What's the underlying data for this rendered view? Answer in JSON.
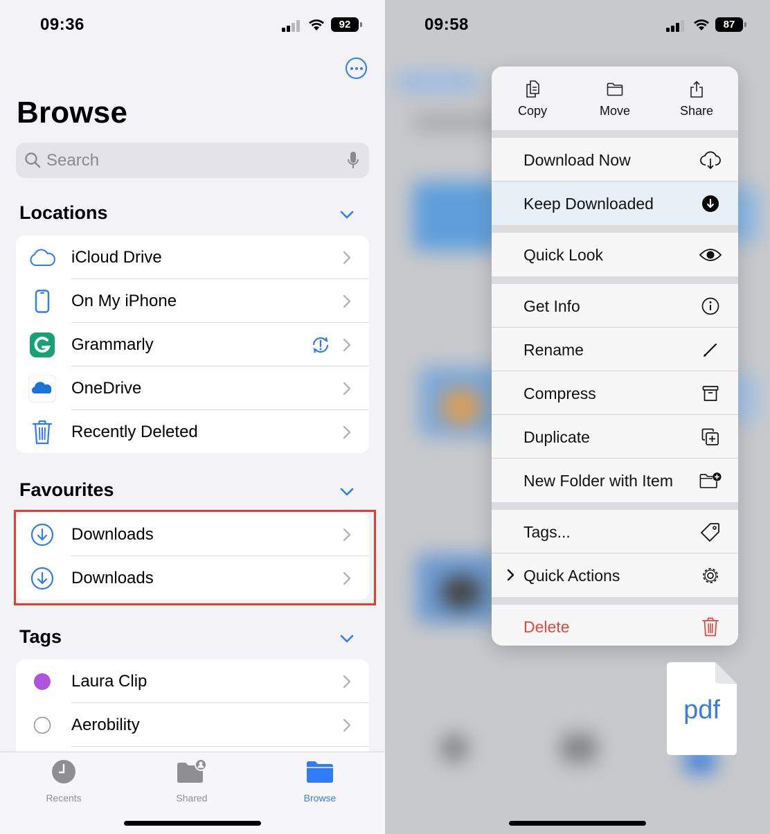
{
  "left": {
    "status": {
      "time": "09:36",
      "battery": "92"
    },
    "title": "Browse",
    "search": {
      "placeholder": "Search"
    },
    "locations": {
      "header": "Locations",
      "items": [
        {
          "label": "iCloud Drive",
          "icon": "icloud-icon"
        },
        {
          "label": "On My iPhone",
          "icon": "iphone-icon"
        },
        {
          "label": "Grammarly",
          "icon": "grammarly-icon"
        },
        {
          "label": "OneDrive",
          "icon": "onedrive-icon"
        },
        {
          "label": "Recently Deleted",
          "icon": "trash-icon"
        }
      ]
    },
    "favourites": {
      "header": "Favourites",
      "items": [
        {
          "label": "Downloads",
          "icon": "download-circle-icon"
        },
        {
          "label": "Downloads",
          "icon": "download-circle-icon"
        }
      ]
    },
    "tags": {
      "header": "Tags",
      "items": [
        {
          "label": "Laura Clip",
          "color": "#af52de"
        },
        {
          "label": "Aerobility",
          "color": "#ffffff"
        }
      ]
    },
    "tabbar": [
      {
        "label": "Recents",
        "icon": "clock-icon"
      },
      {
        "label": "Shared",
        "icon": "shared-folder-icon"
      },
      {
        "label": "Browse",
        "icon": "folder-icon"
      }
    ]
  },
  "right": {
    "status": {
      "time": "09:58",
      "battery": "87"
    },
    "actions": [
      {
        "label": "Copy",
        "icon": "copy-icon"
      },
      {
        "label": "Move",
        "icon": "folder-outline-icon"
      },
      {
        "label": "Share",
        "icon": "share-icon"
      }
    ],
    "menu": {
      "download_now": "Download Now",
      "keep_downloaded": "Keep Downloaded",
      "quick_look": "Quick Look",
      "get_info": "Get Info",
      "rename": "Rename",
      "compress": "Compress",
      "duplicate": "Duplicate",
      "new_folder": "New Folder with Item",
      "tags": "Tags...",
      "quick_actions": "Quick Actions",
      "delete": "Delete"
    },
    "file_label": "pdf"
  },
  "colors": {
    "accent": "#2f7cf6",
    "highlight": "#e0402a",
    "delete": "#e5483a"
  }
}
